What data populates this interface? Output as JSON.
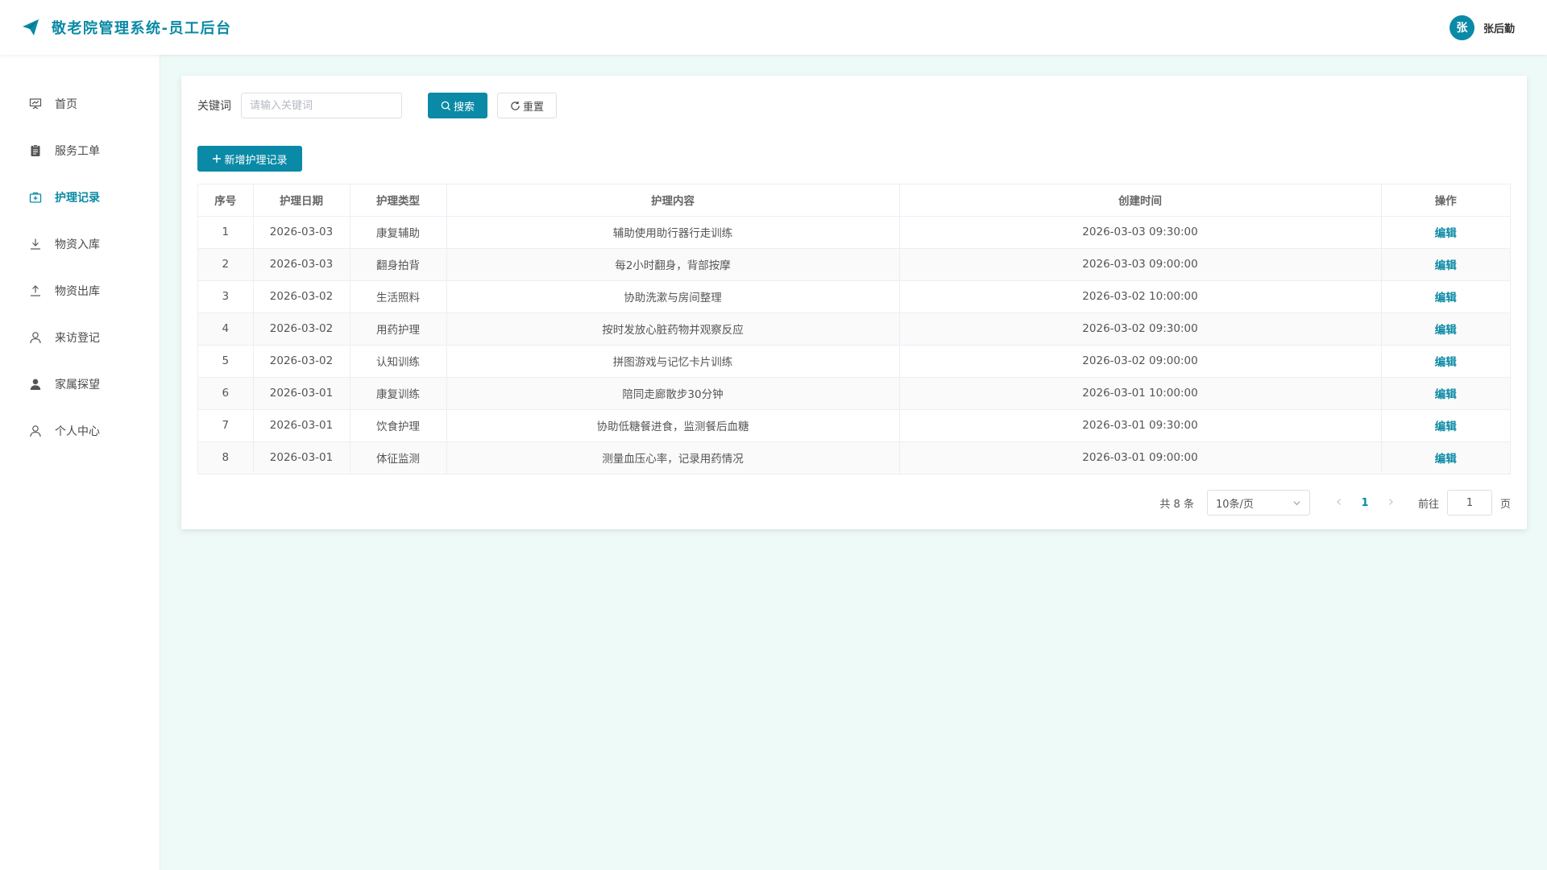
{
  "header": {
    "title": "敬老院管理系统-员工后台",
    "user_initial": "张",
    "user_name": "张后勤"
  },
  "sidebar": {
    "items": [
      {
        "label": "首页",
        "icon": "presentation-board-icon"
      },
      {
        "label": "服务工单",
        "icon": "clipboard-icon"
      },
      {
        "label": "护理记录",
        "icon": "medical-kit-icon",
        "active": true
      },
      {
        "label": "物资入库",
        "icon": "download-icon"
      },
      {
        "label": "物资出库",
        "icon": "upload-icon"
      },
      {
        "label": "来访登记",
        "icon": "user-outline-icon"
      },
      {
        "label": "家属探望",
        "icon": "user-filled-icon"
      },
      {
        "label": "个人中心",
        "icon": "user-outline-icon"
      }
    ]
  },
  "search": {
    "label": "关键词",
    "placeholder": "请输入关键词",
    "value": "",
    "search_button": "搜索",
    "reset_button": "重置"
  },
  "add_button": "新增护理记录",
  "table": {
    "columns": [
      "序号",
      "护理日期",
      "护理类型",
      "护理内容",
      "创建时间",
      "操作"
    ],
    "action_label": "编辑",
    "rows": [
      {
        "index": "1",
        "date": "2026-03-03",
        "type": "康复辅助",
        "content": "辅助使用助行器行走训练",
        "created": "2026-03-03 09:30:00"
      },
      {
        "index": "2",
        "date": "2026-03-03",
        "type": "翻身拍背",
        "content": "每2小时翻身，背部按摩",
        "created": "2026-03-03 09:00:00"
      },
      {
        "index": "3",
        "date": "2026-03-02",
        "type": "生活照料",
        "content": "协助洗漱与房间整理",
        "created": "2026-03-02 10:00:00"
      },
      {
        "index": "4",
        "date": "2026-03-02",
        "type": "用药护理",
        "content": "按时发放心脏药物并观察反应",
        "created": "2026-03-02 09:30:00"
      },
      {
        "index": "5",
        "date": "2026-03-02",
        "type": "认知训练",
        "content": "拼图游戏与记忆卡片训练",
        "created": "2026-03-02 09:00:00"
      },
      {
        "index": "6",
        "date": "2026-03-01",
        "type": "康复训练",
        "content": "陪同走廊散步30分钟",
        "created": "2026-03-01 10:00:00"
      },
      {
        "index": "7",
        "date": "2026-03-01",
        "type": "饮食护理",
        "content": "协助低糖餐进食，监测餐后血糖",
        "created": "2026-03-01 09:30:00"
      },
      {
        "index": "8",
        "date": "2026-03-01",
        "type": "体征监测",
        "content": "测量血压心率，记录用药情况",
        "created": "2026-03-01 09:00:00"
      }
    ]
  },
  "pagination": {
    "total_text": "共 8 条",
    "page_size": "10条/页",
    "current_page": "1",
    "goto_label": "前往",
    "goto_value": "1",
    "page_unit": "页"
  },
  "colors": {
    "accent": "#0a8aa6",
    "background": "#eefaf7"
  }
}
